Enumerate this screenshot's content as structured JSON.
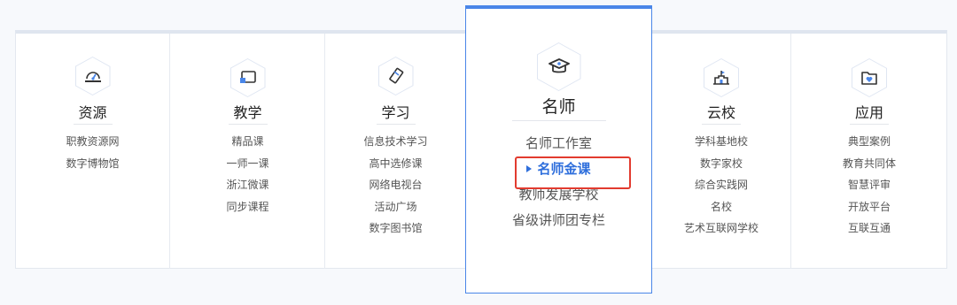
{
  "colors": {
    "accent": "#4a86e8",
    "selected_text": "#2f6fdc",
    "highlight_box": "#e23b2f"
  },
  "columns": [
    {
      "icon": "dashboard-icon",
      "title": "资源",
      "links": [
        "职教资源网",
        "数字博物馆"
      ]
    },
    {
      "icon": "screen-cast-icon",
      "title": "教学",
      "links": [
        "精品课",
        "一师一课",
        "浙江微课",
        "同步课程"
      ]
    },
    {
      "icon": "pencil-icon",
      "title": "学习",
      "links": [
        "信息技术学习",
        "高中选修课",
        "网络电视台",
        "活动广场",
        "数字图书馆"
      ]
    },
    {
      "icon": "graduation-cap-icon",
      "title": "名师",
      "links": [
        "名师工作室",
        "名师金课",
        "教师发展学校",
        "省级讲师团专栏"
      ],
      "selected": "名师金课"
    },
    {
      "icon": "campus-building-icon",
      "title": "云校",
      "links": [
        "学科基地校",
        "数字家校",
        "综合实践网",
        "名校",
        "艺术互联网学校"
      ]
    },
    {
      "icon": "folder-heart-icon",
      "title": "应用",
      "links": [
        "典型案例",
        "教育共同体",
        "智慧评审",
        "开放平台",
        "互联互通"
      ]
    }
  ]
}
